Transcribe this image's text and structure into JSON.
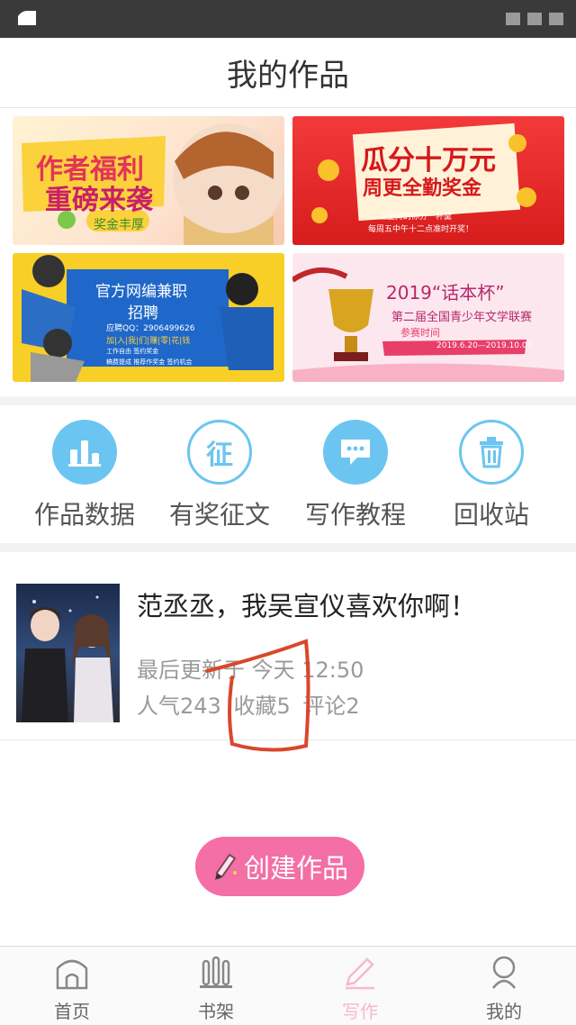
{
  "header": {
    "title": "我的作品"
  },
  "banners": [
    {
      "line1": "作者福利",
      "line2": "重磅来袭",
      "tag": "奖金丰厚"
    },
    {
      "line1": "瓜分十万元",
      "line2": "周更全勤奖金",
      "sub1": "让坚持的你分一杯羹",
      "sub2": "每周五中午十二点准时开奖！"
    },
    {
      "line1": "官方网编兼职",
      "line2": "招聘",
      "contact": "应聘QQ：2906499626",
      "tags": "加|入|我|们|赚|零|花|钱",
      "perks": [
        "工作自由",
        "签约奖金",
        "稿费提成",
        "推荐作奖金",
        "签约机会"
      ]
    },
    {
      "line1": "2019“话本杯”",
      "line2": "第二届全国青少年文学联赛",
      "dates": "2019.6.20—2019.10.07",
      "dates_label": "参赛时间"
    }
  ],
  "features": [
    {
      "label": "作品数据",
      "icon": "bar-chart-icon"
    },
    {
      "label": "有奖征文",
      "icon": "zheng-icon",
      "glyph": "征"
    },
    {
      "label": "写作教程",
      "icon": "chat-bubble-icon"
    },
    {
      "label": "回收站",
      "icon": "trash-icon"
    }
  ],
  "work": {
    "title": "范丞丞，我吴宣仪喜欢你啊！",
    "update": "最后更新于 今天 12:50",
    "stats": {
      "popularity": "人气243",
      "favorites": "收藏5",
      "comments": "评论2"
    }
  },
  "create_button": {
    "label": "创建作品"
  },
  "tabs": [
    {
      "label": "首页",
      "icon": "home-icon"
    },
    {
      "label": "书架",
      "icon": "bookshelf-icon"
    },
    {
      "label": "写作",
      "icon": "pencil-icon",
      "active": true
    },
    {
      "label": "我的",
      "icon": "profile-icon"
    }
  ],
  "colors": {
    "accent": "#f36fa6",
    "feature_icon": "#6cc5f0",
    "active_tab": "#f8b7cf",
    "annotation": "#d9472b"
  }
}
